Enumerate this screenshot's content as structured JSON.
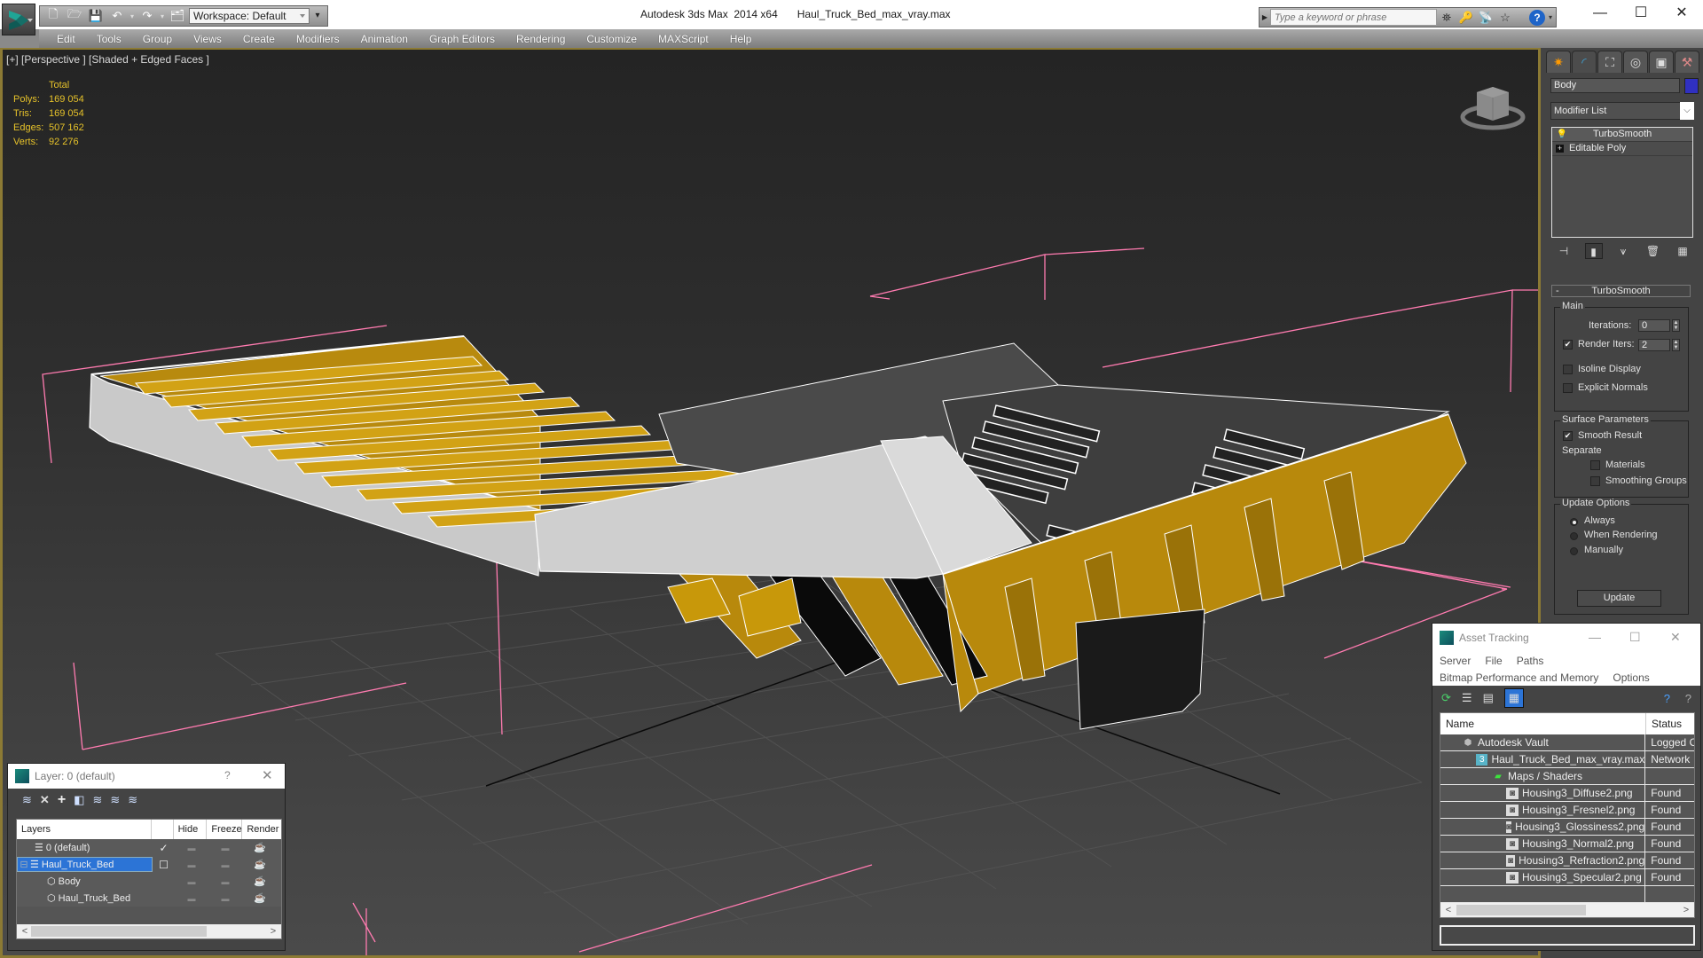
{
  "window": {
    "app_title": "Autodesk 3ds Max  2014 x64",
    "file_title": "Haul_Truck_Bed_max_vray.max",
    "controls": {
      "minimize": "—",
      "maximize": "☐",
      "close": "✕"
    }
  },
  "quick_access": {
    "icons": [
      "new-file-icon",
      "open-file-icon",
      "save-icon",
      "undo-icon",
      "redo-icon",
      "project-folder-icon"
    ],
    "workspace_label": "Workspace: Default"
  },
  "search": {
    "placeholder": "Type a keyword or phrase",
    "icons": [
      "binoculars-icon",
      "key-icon",
      "satellite-icon",
      "star-icon",
      "help-icon"
    ]
  },
  "menu": [
    "Edit",
    "Tools",
    "Group",
    "Views",
    "Create",
    "Modifiers",
    "Animation",
    "Graph Editors",
    "Rendering",
    "Customize",
    "MAXScript",
    "Help"
  ],
  "viewport": {
    "label": "[+] [Perspective ] [Shaded + Edged Faces ]",
    "stats": {
      "header": "Total",
      "rows": [
        {
          "label": "Polys:",
          "value": "169 054"
        },
        {
          "label": "Tris:",
          "value": "169 054"
        },
        {
          "label": "Edges:",
          "value": "507 162"
        },
        {
          "label": "Verts:",
          "value": "92 276"
        }
      ]
    },
    "colors": {
      "model_yellow": "#c8980a",
      "model_white": "#d8d8d8",
      "bbox_pink": "#ff7bb0",
      "grid": "#555555"
    }
  },
  "command_panel": {
    "tabs": [
      "create-tab",
      "modify-tab",
      "hierarchy-tab",
      "motion-tab",
      "display-tab",
      "utilities-tab"
    ],
    "object_name": "Body",
    "object_color": "#3030c0",
    "modifier_list_label": "Modifier List",
    "stack": [
      {
        "name": "TurboSmooth",
        "selected": true
      },
      {
        "name": "Editable Poly",
        "selected": false
      }
    ],
    "rollout_title": "TurboSmooth",
    "main": {
      "group_label": "Main",
      "iterations_label": "Iterations:",
      "iterations_value": "0",
      "render_iters_label": "Render Iters:",
      "render_iters_value": "2",
      "render_iters_checked": true,
      "isoline_label": "Isoline Display",
      "isoline_checked": false,
      "explicit_normals_label": "Explicit Normals",
      "explicit_normals_checked": false
    },
    "surface": {
      "group_label": "Surface Parameters",
      "smooth_result_label": "Smooth Result",
      "smooth_result_checked": true,
      "separate_label": "Separate",
      "materials_label": "Materials",
      "smoothing_groups_label": "Smoothing Groups"
    },
    "update": {
      "group_label": "Update Options",
      "options": [
        "Always",
        "When Rendering",
        "Manually"
      ],
      "selected": "Always",
      "button_label": "Update"
    }
  },
  "layer_dialog": {
    "title": "Layer: 0 (default)",
    "help": "?",
    "close": "✕",
    "columns": [
      "Layers",
      "",
      "Hide",
      "Freeze",
      "Render"
    ],
    "rows": [
      {
        "name": "0 (default)",
        "indent": 1,
        "current": "✓",
        "selected": false,
        "type": "layer"
      },
      {
        "name": "Haul_Truck_Bed",
        "indent": 0,
        "current": "☐",
        "selected": true,
        "type": "layer"
      },
      {
        "name": "Body",
        "indent": 2,
        "current": "",
        "selected": false,
        "type": "object"
      },
      {
        "name": "Haul_Truck_Bed",
        "indent": 2,
        "current": "",
        "selected": false,
        "type": "object"
      }
    ]
  },
  "asset_tracking": {
    "title": "Asset Tracking",
    "menu_row1": [
      "Server",
      "File",
      "Paths"
    ],
    "menu_row2": [
      "Bitmap Performance and Memory",
      "Options"
    ],
    "columns": {
      "name": "Name",
      "status": "Status"
    },
    "rows": [
      {
        "name": "Autodesk Vault",
        "status": "Logged Out",
        "indent": 1,
        "icon": "vault-icon"
      },
      {
        "name": "Haul_Truck_Bed_max_vray.max",
        "status": "Network",
        "indent": 2,
        "icon": "max-file-icon"
      },
      {
        "name": "Maps / Shaders",
        "status": "",
        "indent": 3,
        "icon": "maps-icon"
      },
      {
        "name": "Housing3_Diffuse2.png",
        "status": "Found",
        "indent": 4,
        "icon": "bitmap-icon"
      },
      {
        "name": "Housing3_Fresnel2.png",
        "status": "Found",
        "indent": 4,
        "icon": "bitmap-icon"
      },
      {
        "name": "Housing3_Glossiness2.png",
        "status": "Found",
        "indent": 4,
        "icon": "bitmap-icon"
      },
      {
        "name": "Housing3_Normal2.png",
        "status": "Found",
        "indent": 4,
        "icon": "bitmap-icon"
      },
      {
        "name": "Housing3_Refraction2.png",
        "status": "Found",
        "indent": 4,
        "icon": "bitmap-icon"
      },
      {
        "name": "Housing3_Specular2.png",
        "status": "Found",
        "indent": 4,
        "icon": "bitmap-icon"
      }
    ]
  }
}
